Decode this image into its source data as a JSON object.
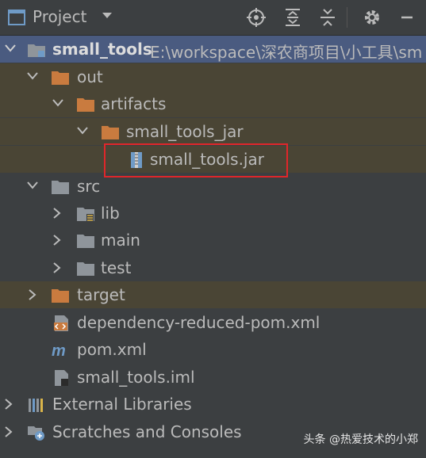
{
  "toolbar": {
    "title": "Project",
    "icons": [
      "locate-icon",
      "expand-all-icon",
      "collapse-all-icon",
      "gear-icon",
      "minimize-icon"
    ]
  },
  "tree": {
    "root": {
      "name": "small_tools",
      "path": "E:\\workspace\\深农商项目\\小工具\\sm"
    },
    "out": "out",
    "artifacts": "artifacts",
    "small_tools_jar": "small_tools_jar",
    "jar_file": "small_tools.jar",
    "src": "src",
    "lib": "lib",
    "main": "main",
    "test": "test",
    "target": "target",
    "dependency_pom": "dependency-reduced-pom.xml",
    "pom": "pom.xml",
    "iml": "small_tools.iml",
    "external_libraries": "External Libraries",
    "scratches": "Scratches and Consoles"
  },
  "watermark": "头条 @热爱技术的小郑",
  "colors": {
    "background": "#3c3f41",
    "selected_row": "#4a5b80",
    "excluded_row": "#4a4535",
    "folder_orange": "#c97b3f",
    "folder_gray": "#8f959b",
    "highlight_box": "#e0262a"
  }
}
